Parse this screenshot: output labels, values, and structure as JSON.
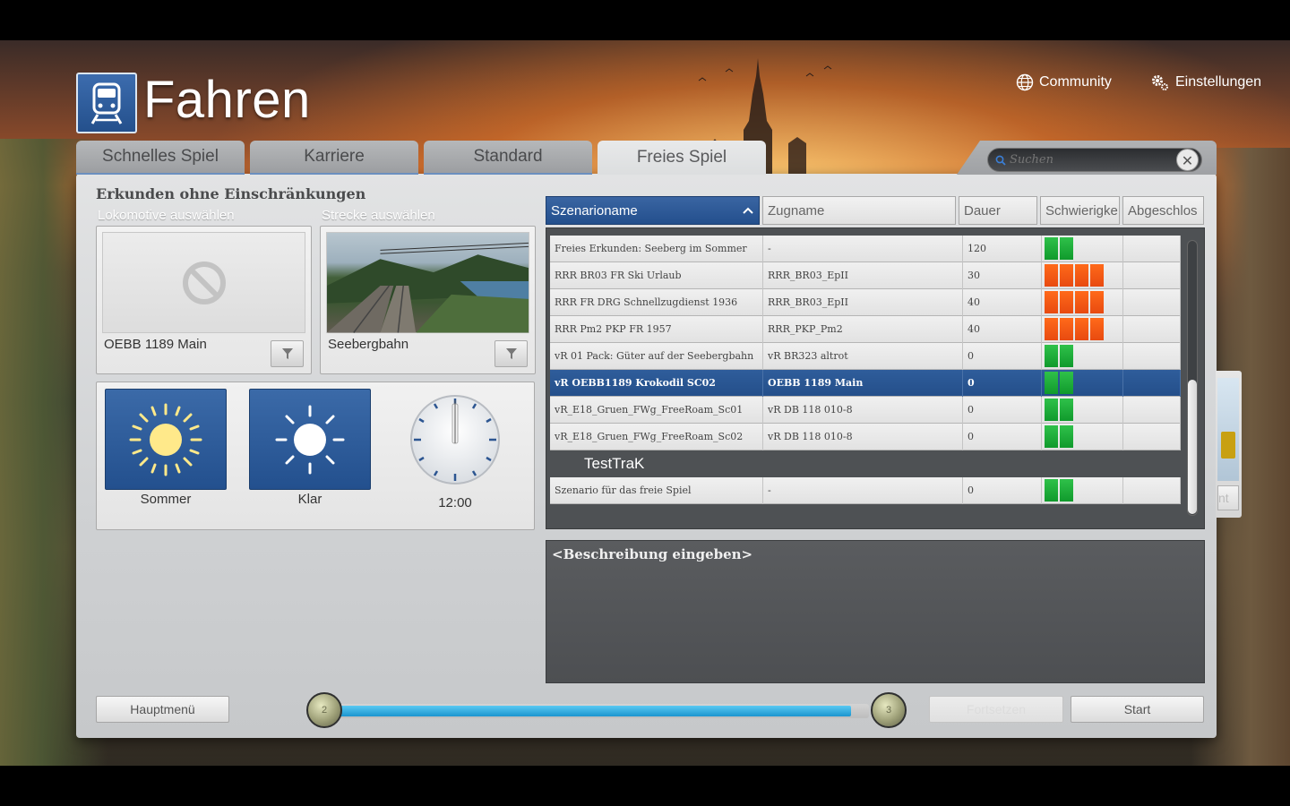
{
  "header": {
    "title": "Fahren",
    "community_label": "Community",
    "settings_label": "Einstellungen"
  },
  "tabs": [
    {
      "label": "Schnelles Spiel",
      "active": false
    },
    {
      "label": "Karriere",
      "active": false
    },
    {
      "label": "Standard",
      "active": false
    },
    {
      "label": "Freies Spiel",
      "active": true
    }
  ],
  "search": {
    "placeholder": "Suchen",
    "value": ""
  },
  "left": {
    "section_title": "Erkunden ohne Einschränkungen",
    "loco_label": "Lokomotive auswählen",
    "route_label": "Strecke auswählen",
    "loco_name": "OEBB 1189 Main",
    "route_name": "Seebergbahn",
    "season": "Sommer",
    "weather": "Klar",
    "time": "12:00"
  },
  "table": {
    "headers": [
      "Szenarioname",
      "Zugname",
      "Dauer",
      "Schwierigke",
      "Abgeschlos"
    ],
    "rows": [
      {
        "name": "Freies Erkunden: Seeberg im Sommer",
        "train": "-",
        "duration": "120",
        "difficulty": 2,
        "diff_color": "green",
        "selected": false
      },
      {
        "name": "RRR BR03 FR Ski Urlaub",
        "train": "RRR_BR03_EpII",
        "duration": "30",
        "difficulty": 4,
        "diff_color": "orange",
        "selected": false
      },
      {
        "name": "RRR FR DRG Schnellzugdienst 1936",
        "train": "RRR_BR03_EpII",
        "duration": "40",
        "difficulty": 4,
        "diff_color": "orange",
        "selected": false
      },
      {
        "name": "RRR Pm2 PKP FR 1957",
        "train": "RRR_PKP_Pm2",
        "duration": "40",
        "difficulty": 4,
        "diff_color": "orange",
        "selected": false
      },
      {
        "name": "vR 01 Pack: Güter auf der Seebergbahn",
        "train": "vR BR323 altrot",
        "duration": "0",
        "difficulty": 2,
        "diff_color": "green",
        "selected": false
      },
      {
        "name": "vR OEBB1189 Krokodil SC02",
        "train": "OEBB 1189 Main",
        "duration": "0",
        "difficulty": 2,
        "diff_color": "green",
        "selected": true
      },
      {
        "name": "vR_E18_Gruen_FWg_FreeRoam_Sc01",
        "train": "vR DB 118 010-8",
        "duration": "0",
        "difficulty": 2,
        "diff_color": "green",
        "selected": false
      },
      {
        "name": "vR_E18_Gruen_FWg_FreeRoam_Sc02",
        "train": "vR DB 118 010-8",
        "duration": "0",
        "difficulty": 2,
        "diff_color": "green",
        "selected": false
      }
    ],
    "group_label": "TestTraK",
    "group_rows": [
      {
        "name": "Szenario für das freie Spiel",
        "train": "-",
        "duration": "0",
        "difficulty": 2,
        "diff_color": "green",
        "selected": false
      }
    ]
  },
  "description": "<Beschreibung eingeben>",
  "footer": {
    "main_menu": "Hauptmenü",
    "continue": "Fortsetzen",
    "start": "Start",
    "step_from": "2",
    "step_to": "3",
    "progress": 0.97
  },
  "side_peek_text": "nt",
  "colors": {
    "accent_blue": "#2f5d9b",
    "difficulty_green": "#1fae3b",
    "difficulty_orange": "#f45a16",
    "progress": "#2aa8dd"
  }
}
